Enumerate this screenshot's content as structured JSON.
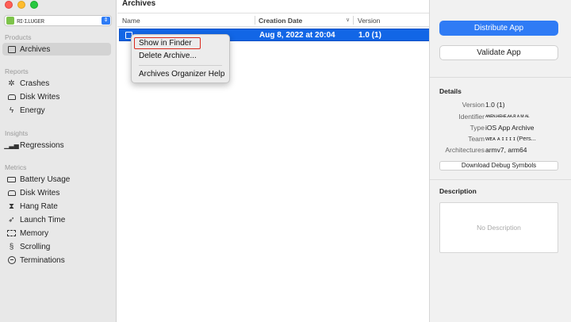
{
  "window": {
    "title": "Archives"
  },
  "app_picker": {
    "app_name": "ʀɪ·ɪ.ʟᴜɢᴇʀ",
    "icon_color": "#7dc34a"
  },
  "sidebar": {
    "sections": {
      "products": "Products",
      "reports": "Reports",
      "insights": "Insights",
      "metrics": "Metrics"
    },
    "items": {
      "archives": "Archives",
      "crashes": "Crashes",
      "disk_writes_report": "Disk Writes",
      "energy": "Energy",
      "regressions": "Regressions",
      "battery_usage": "Battery Usage",
      "disk_writes_metric": "Disk Writes",
      "hang_rate": "Hang Rate",
      "launch_time": "Launch Time",
      "memory": "Memory",
      "scrolling": "Scrolling",
      "terminations": "Terminations"
    }
  },
  "table": {
    "columns": {
      "name": "Name",
      "creation_date": "Creation Date",
      "version": "Version"
    },
    "rows": [
      {
        "creation_date": "Aug 8, 2022 at 20:04",
        "version": "1.0 (1)"
      }
    ]
  },
  "context_menu": {
    "items": {
      "show_in_finder": "Show in Finder",
      "delete_archive": "Delete Archive...",
      "help": "Archives Organizer Help"
    },
    "highlight_color": "#d9281c"
  },
  "inspector": {
    "distribute_button": "Distribute App",
    "validate_button": "Validate App",
    "details_heading": "Details",
    "details": {
      "version_label": "Version",
      "version_value": "1.0 (1)",
      "identifier_label": "Identifier",
      "identifier_value": "ᴀɴᴇɴ.ʜᴇʜᴇ.ᴀᴀ.ʀ ᴀ ᴍ ᴀʟ",
      "type_label": "Type",
      "type_value": "iOS App Archive",
      "team_label": "Team",
      "team_value": "ᴡᴇᴀ ᴀ ɪ ɪ ɪ ɪ (Pers...",
      "architectures_label": "Architectures",
      "architectures_value": "armv7, arm64"
    },
    "download_symbols_button": "Download Debug Symbols",
    "description_heading": "Description",
    "description_placeholder": "No Description"
  },
  "colors": {
    "accent": "#2f7bf5",
    "selection": "#1266e6",
    "sidebar_bg": "#e8e8e8",
    "inspector_bg": "#f1f1f1"
  }
}
